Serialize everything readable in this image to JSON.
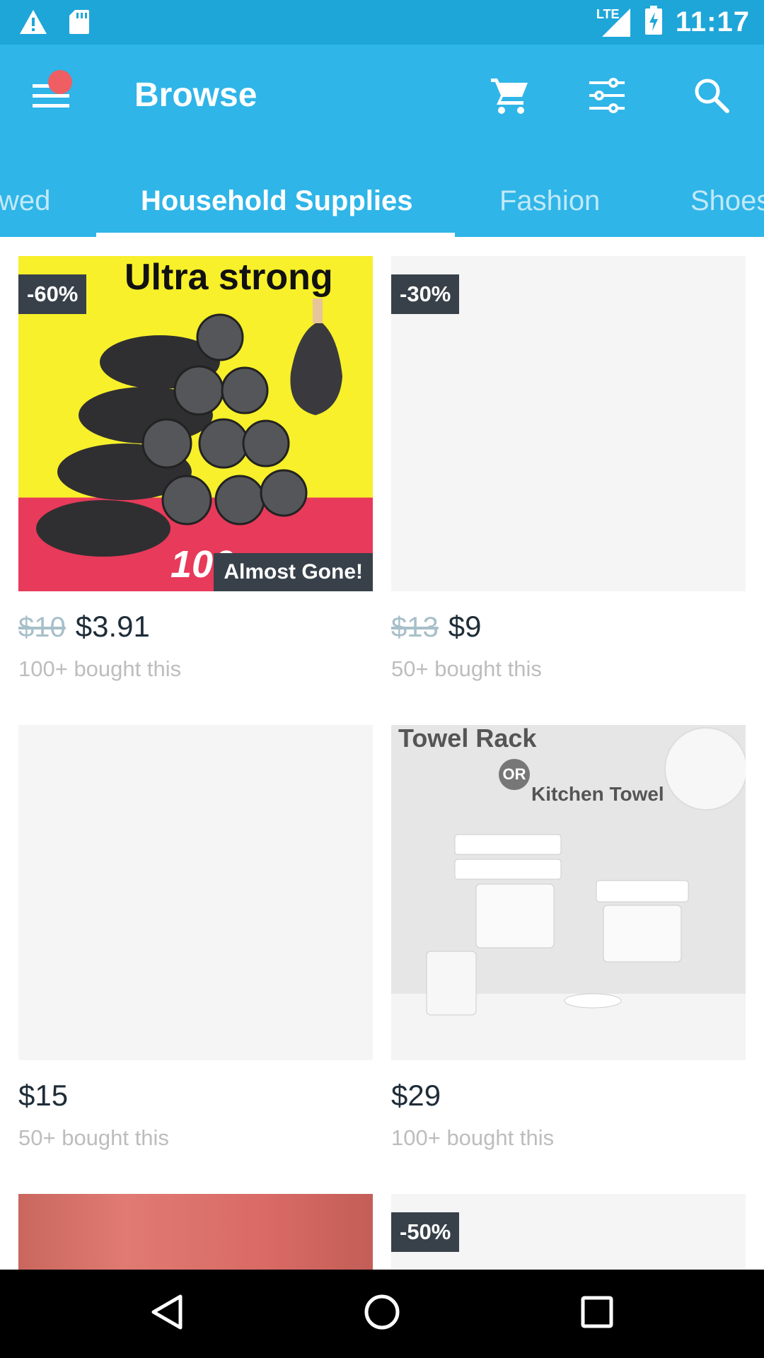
{
  "status_bar": {
    "time": "11:17",
    "network": "LTE",
    "icons": [
      "warning-icon",
      "sd-card-icon",
      "signal-icon",
      "battery-charging-icon"
    ]
  },
  "app_bar": {
    "title": "Browse",
    "menu_badge_color": "#ee5e62",
    "actions": [
      "cart-icon",
      "filter-icon",
      "search-icon"
    ]
  },
  "tabs": [
    {
      "label": "wed",
      "active": false
    },
    {
      "label": "Household Supplies",
      "active": true
    },
    {
      "label": "Fashion",
      "active": false
    },
    {
      "label": "Shoes",
      "active": false
    }
  ],
  "products": [
    {
      "badge": "-60%",
      "image_text_top": "Ultra strong",
      "image_text_bottom": "100 pcs",
      "tag": "Almost Gone!",
      "old_price": "$10",
      "price": "$3.91",
      "bought": "100+ bought this"
    },
    {
      "badge": "-30%",
      "old_price": "$13",
      "price": "$9",
      "bought": "50+ bought this"
    },
    {
      "price": "$15",
      "bought": "50+ bought this"
    },
    {
      "image_text_top": "Towel Rack",
      "image_text_mid": "OR",
      "image_text_bottom": "Kitchen Towel",
      "price": "$29",
      "bought": "100+ bought this"
    },
    {
      "badge": ""
    },
    {
      "badge": "-50%"
    }
  ],
  "colors": {
    "status_bar": "#1ea6d9",
    "app_bar": "#2fb5e8",
    "badge_bg": "#38414a",
    "old_price": "#a7bfc9",
    "price": "#1f2d38",
    "muted": "#bdbdbd"
  }
}
